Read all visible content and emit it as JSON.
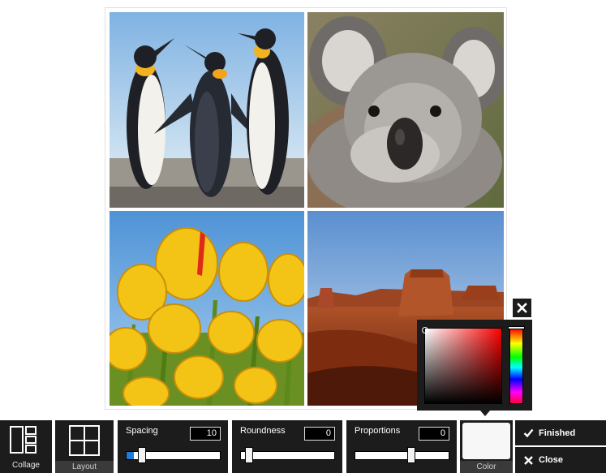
{
  "toolbar": {
    "collage_label": "Collage",
    "layout_label": "Layout",
    "spacing": {
      "label": "Spacing",
      "value": "10",
      "level": 0.08
    },
    "roundness": {
      "label": "Roundness",
      "value": "0",
      "level": 0.0
    },
    "proportions": {
      "label": "Proportions",
      "value": "0",
      "level": 0.5
    },
    "color_label": "Color",
    "finished_label": "Finished",
    "close_label": "Close"
  },
  "color_picker": {
    "selected_color": "#f7f7f7",
    "hue": "#ff0000"
  },
  "colors": {
    "toolbar_bg": "#1c1c1c",
    "accent": "#1e7bd6"
  },
  "collage": {
    "photos": [
      {
        "name": "penguins"
      },
      {
        "name": "koala"
      },
      {
        "name": "tulips"
      },
      {
        "name": "desert"
      }
    ]
  }
}
